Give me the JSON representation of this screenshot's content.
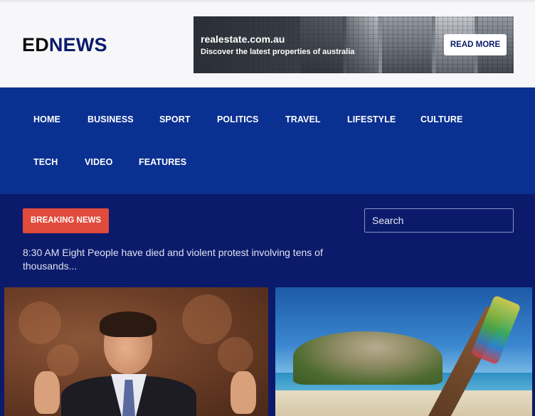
{
  "logo": {
    "part1": "ED",
    "part2": "NEWS"
  },
  "ad": {
    "site": "realestate.com.au",
    "tagline": "Discover the latest properties of australia",
    "button": "READ MORE"
  },
  "nav": {
    "items": [
      "HOME",
      "BUSINESS",
      "SPORT",
      "POLITICS",
      "TRAVEL",
      "LIFESTYLE",
      "CULTURE",
      "TECH",
      "VIDEO",
      "FEATURES"
    ]
  },
  "breaking": {
    "badge": "BREAKING NEWS",
    "search_placeholder": "Search",
    "ticker": "8:30 AM Eight People have died and violent protest involving tens of thousands..."
  },
  "colors": {
    "brand_dark": "#0b1a6b",
    "nav_blue": "#0a3091",
    "breaking_red": "#e14b3c"
  }
}
